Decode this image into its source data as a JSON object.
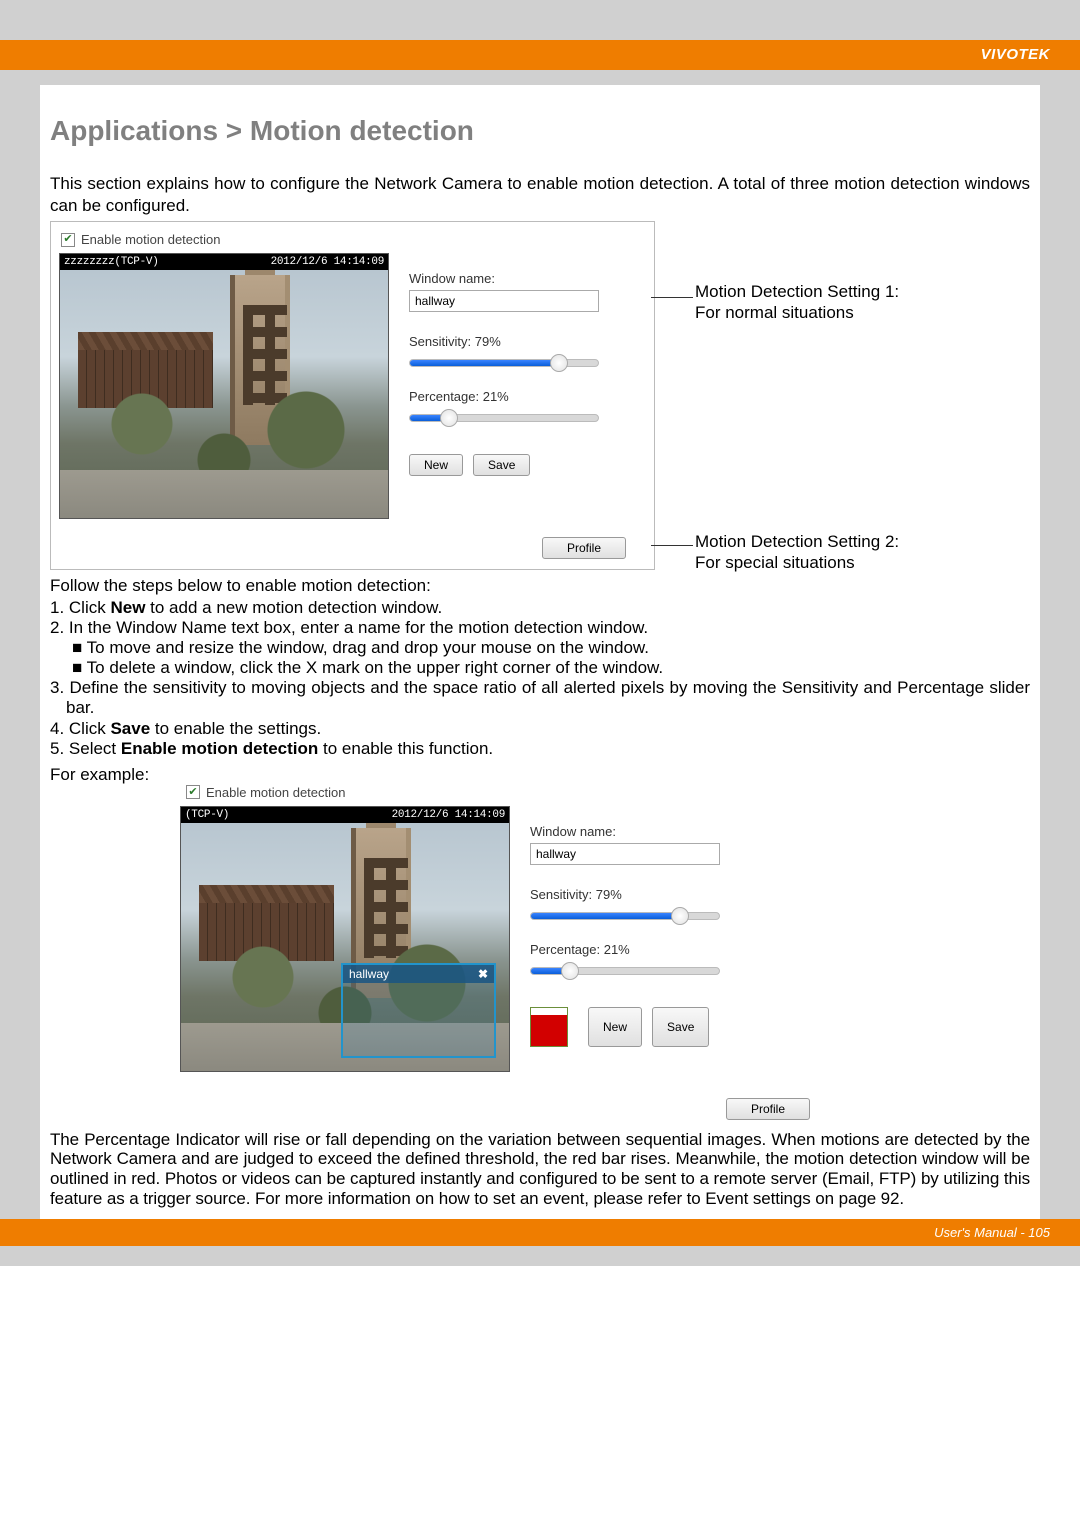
{
  "brand": "VIVOTEK",
  "footer": "User's Manual - 105",
  "title": "Applications > Motion detection",
  "intro": "This section explains how to configure the Network Camera to enable motion detection. A total of three motion detection windows can be configured.",
  "panel1": {
    "enable_label": "Enable motion detection",
    "camera_name": "zzzzzzzz(TCP-V)",
    "timestamp": "2012/12/6 14:14:09",
    "window_name_label": "Window name:",
    "window_name": "hallway",
    "sensitivity_label": "Sensitivity: 79%",
    "sensitivity_pct": 79,
    "percentage_label": "Percentage: 21%",
    "percentage_pct": 21,
    "new_btn": "New",
    "save_btn": "Save",
    "profile_btn": "Profile"
  },
  "anno1_l1": "Motion Detection Setting 1:",
  "anno1_l2": "For normal situations",
  "anno2_l1": "Motion Detection Setting 2:",
  "anno2_l2": "For special situations",
  "steps_lead": "Follow the steps below to enable motion detection:",
  "step1": "1. Click New to add a new motion detection window.",
  "step2": "2. In the Window Name text box, enter a name for the motion detection window.",
  "step2a": "■ To move and resize the window, drag and drop your mouse on the window.",
  "step2b": "■ To delete a window, click the X mark on the upper right corner of the window.",
  "step3": "3. Define the sensitivity to moving objects and the space ratio of all alerted pixels by moving the Sensitivity and Percentage slider bar.",
  "step4": "4. Click Save to enable the settings.",
  "step5": "5. Select Enable motion detection to enable this function.",
  "example_label": "For example:",
  "panel2": {
    "enable_label": "Enable motion detection",
    "camera_name": "(TCP-V)",
    "timestamp": "2012/12/6 14:14:09",
    "window_name_label": "Window name:",
    "window_name": "hallway",
    "sensitivity_label": "Sensitivity: 79%",
    "sensitivity_pct": 79,
    "percentage_label": "Percentage: 21%",
    "percentage_pct": 21,
    "new_btn": "New",
    "save_btn": "Save",
    "profile_btn": "Profile",
    "overlay_title": "hallway",
    "overlay_close": "✖",
    "indicator_pct": 80
  },
  "body_text": "The Percentage Indicator will rise or fall depending on the variation between sequential images. When motions are detected by the Network Camera and are judged to exceed the defined threshold, the red bar rises. Meanwhile, the motion detection window will be outlined in red. Photos or videos can be captured instantly and configured to be sent to a remote server (Email, FTP) by utilizing this feature as a trigger source. For more information on how to set an event, please refer to Event settings on page 92."
}
